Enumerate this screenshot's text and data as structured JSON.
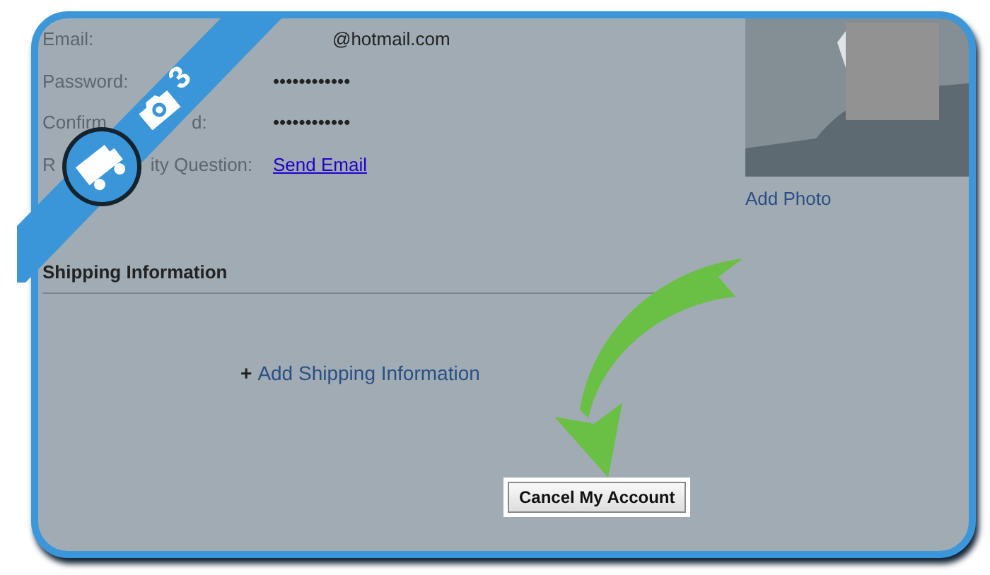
{
  "account_fields": [
    {
      "label_parts": [
        "Email:"
      ],
      "value": "@hotmail.com",
      "kind": "text"
    },
    {
      "label_parts": [
        "Password:"
      ],
      "value": "••••••••••••",
      "kind": "text"
    },
    {
      "label_parts": [
        "Confirm",
        "d:"
      ],
      "value": "••••••••••••",
      "kind": "text"
    },
    {
      "label_parts": [
        "R",
        "ity Question:"
      ],
      "value": "Send Email",
      "kind": "link"
    }
  ],
  "photo": {
    "kind": "picture",
    "link": "Add Photo"
  },
  "shipping": {
    "heading": "Shipping Information",
    "add_icon": "+",
    "add_link": "Add Shipping Information"
  },
  "cancel_button": "Cancel My Account",
  "step_ribbon": {
    "step": "3"
  }
}
